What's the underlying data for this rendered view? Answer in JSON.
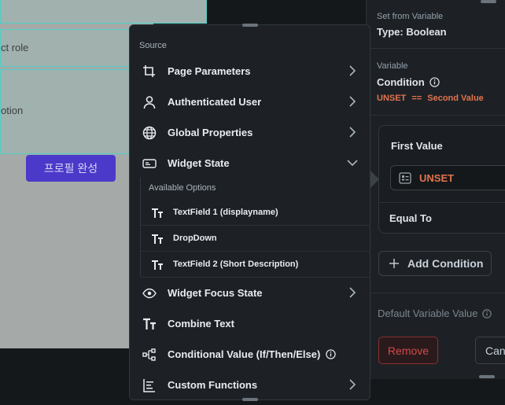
{
  "canvas": {
    "field1_text": "",
    "field2_text": "ct role",
    "field3_text": "otion",
    "profile_button": "프로필 완성"
  },
  "menu": {
    "source_label": "Source",
    "items": [
      {
        "label": "Page Parameters",
        "icon": "crop-icon",
        "chevron": "right"
      },
      {
        "label": "Authenticated User",
        "icon": "user-icon",
        "chevron": "right"
      },
      {
        "label": "Global Properties",
        "icon": "globe-icon",
        "chevron": "right"
      },
      {
        "label": "Widget State",
        "icon": "widget-icon",
        "chevron": "down"
      }
    ],
    "available_label": "Available Options",
    "options": [
      {
        "label": "TextField 1 (displayname)",
        "icon": "text-icon"
      },
      {
        "label": "DropDown",
        "icon": "text-icon"
      },
      {
        "label": "TextField 2 (Short Description)",
        "icon": "text-icon"
      }
    ],
    "items_after": [
      {
        "label": "Widget Focus State",
        "icon": "eye-icon",
        "chevron": "right"
      },
      {
        "label": "Combine Text",
        "icon": "text-icon",
        "chevron": ""
      },
      {
        "label": "Conditional Value (If/Then/Else)",
        "icon": "branch-icon",
        "chevron": "",
        "info": true
      },
      {
        "label": "Custom Functions",
        "icon": "function-icon",
        "chevron": "right"
      }
    ]
  },
  "panel": {
    "set_from_label": "Set from Variable",
    "type_label": "Type: Boolean",
    "variable_label": "Variable",
    "condition_label": "Condition",
    "expr_left": "UNSET",
    "expr_op": "==",
    "expr_right": "Second Value",
    "first_value_label": "First Value",
    "unset_value": "UNSET",
    "equal_to_label": "Equal To",
    "add_condition": "Add Condition",
    "default_value_label": "Default Variable Value",
    "remove": "Remove",
    "cancel": "Canc"
  },
  "colors": {
    "accent_orange": "#e2734f",
    "danger": "#d14a4a",
    "button_purple": "#4b39c9",
    "field_outline": "#4fd1c5"
  }
}
